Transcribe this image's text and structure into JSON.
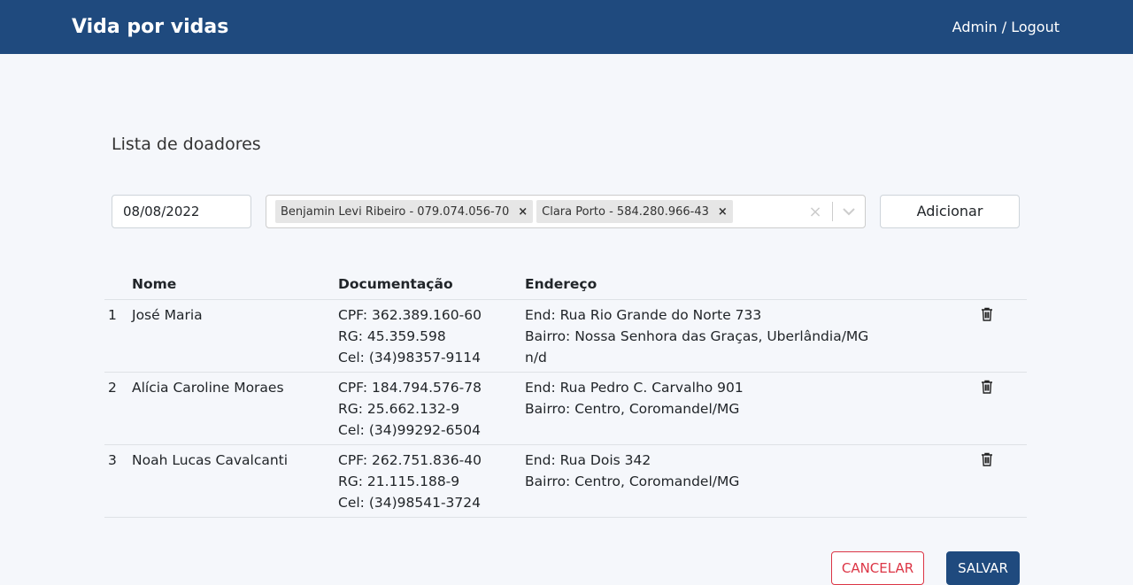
{
  "header": {
    "brand": "Vida por vidas",
    "admin_label": "Admin",
    "separator": " / ",
    "logout_label": "Logout"
  },
  "page": {
    "title": "Lista de doadores"
  },
  "form": {
    "date_value": "08/08/2022",
    "selected_donors": [
      "Benjamin Levi Ribeiro - 079.074.056-70",
      "Clara Porto - 584.280.966-43"
    ],
    "add_label": "Adicionar"
  },
  "table": {
    "headers": {
      "name": "Nome",
      "docs": "Documentação",
      "address": "Endereço"
    },
    "rows": [
      {
        "index": "1",
        "name": "José Maria",
        "cpf": "CPF: 362.389.160-60",
        "rg": "RG: 45.359.598",
        "cel": "Cel: (34)98357-9114",
        "end": "End: Rua Rio Grande do Norte 733",
        "bairro": "Bairro: Nossa Senhora das Graças, Uberlândia/MG",
        "extra": "n/d"
      },
      {
        "index": "2",
        "name": "Alícia Caroline Moraes",
        "cpf": "CPF: 184.794.576-78",
        "rg": "RG: 25.662.132-9",
        "cel": "Cel: (34)99292-6504",
        "end": "End: Rua Pedro C. Carvalho 901",
        "bairro": "Bairro: Centro, Coromandel/MG",
        "extra": ""
      },
      {
        "index": "3",
        "name": "Noah Lucas Cavalcanti",
        "cpf": "CPF: 262.751.836-40",
        "rg": "RG: 21.115.188-9",
        "cel": "Cel: (34)98541-3724",
        "end": "End: Rua Dois 342",
        "bairro": "Bairro: Centro, Coromandel/MG",
        "extra": ""
      }
    ]
  },
  "actions": {
    "cancel_label": "CANCELAR",
    "save_label": "SALVAR"
  },
  "colors": {
    "navbar": "#1f4a7e",
    "cancel": "#dc3545",
    "background": "#f5f7fb"
  },
  "icons": {
    "chip_remove": "x-icon",
    "clear": "clear-icon",
    "dropdown": "chevron-down-icon",
    "delete": "trash-icon"
  }
}
